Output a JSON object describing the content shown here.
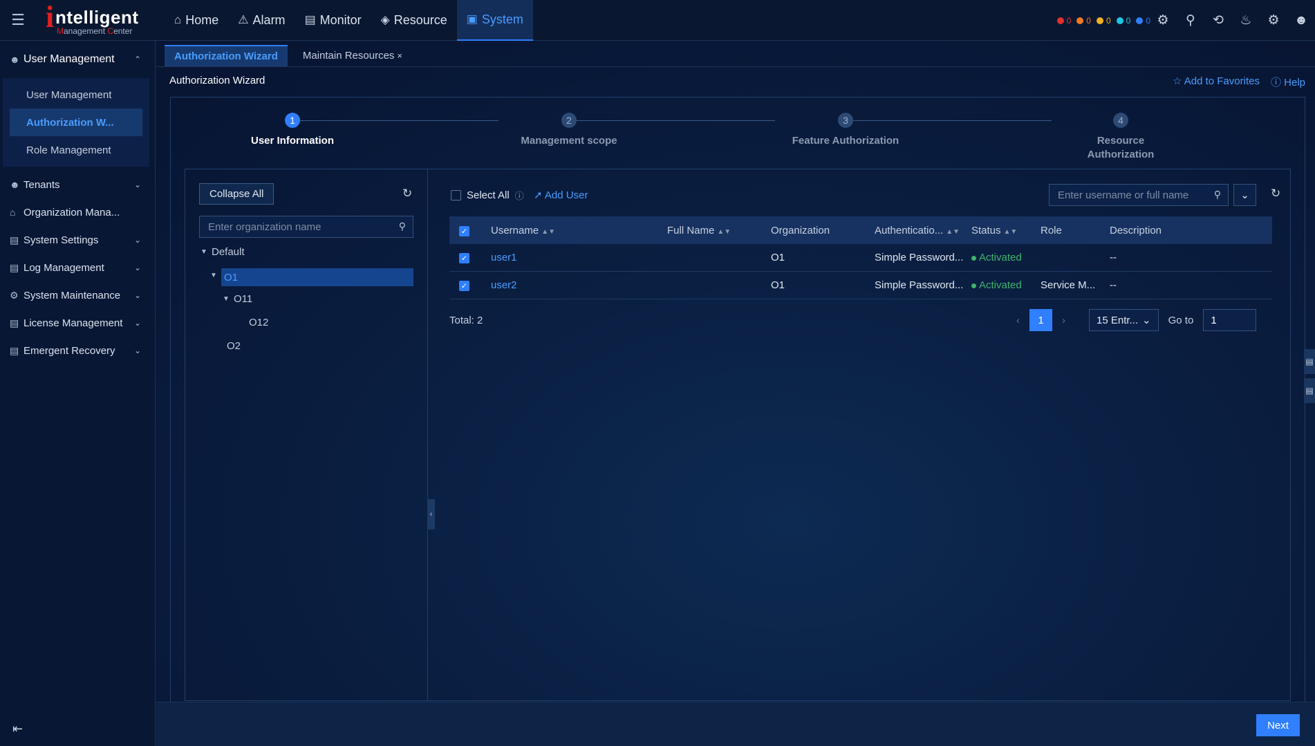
{
  "header": {
    "logo_main": "ntelligent",
    "logo_i": "i",
    "logo_sub_m": "M",
    "logo_sub_a": "anagement ",
    "logo_sub_c": "C",
    "logo_sub_b": "enter",
    "nav": [
      {
        "label": "Home",
        "icon": "home-icon"
      },
      {
        "label": "Alarm",
        "icon": "alarm-icon"
      },
      {
        "label": "Monitor",
        "icon": "monitor-icon"
      },
      {
        "label": "Resource",
        "icon": "resource-icon"
      },
      {
        "label": "System",
        "icon": "system-icon",
        "active": true
      }
    ],
    "alarms": [
      {
        "color": "#e0312f",
        "count": "0"
      },
      {
        "color": "#f07b1e",
        "count": "0"
      },
      {
        "color": "#f0b21e",
        "count": "0"
      },
      {
        "color": "#1ec9e0",
        "count": "0"
      },
      {
        "color": "#2f7fff",
        "count": "0"
      }
    ]
  },
  "sidebar": {
    "groups": [
      {
        "label": "User Management",
        "open": true
      },
      {
        "label": "Tenants"
      },
      {
        "label": "Organization Mana..."
      },
      {
        "label": "System Settings"
      },
      {
        "label": "Log Management"
      },
      {
        "label": "System Maintenance"
      },
      {
        "label": "License Management"
      },
      {
        "label": "Emergent Recovery"
      }
    ],
    "sub_items": [
      "User Management",
      "Authorization W...",
      "Role Management"
    ]
  },
  "tabs": [
    {
      "label": "Authorization Wizard",
      "active": true
    },
    {
      "label": "Maintain Resources",
      "close": "×"
    }
  ],
  "page": {
    "title": "Authorization Wizard",
    "favorites": "Add to Favorites",
    "help": "Help"
  },
  "steps": [
    {
      "num": "1",
      "label": "User Information",
      "active": true
    },
    {
      "num": "2",
      "label": "Management scope"
    },
    {
      "num": "3",
      "label": "Feature Authorization"
    },
    {
      "num": "4",
      "label": "Resource Authorization"
    }
  ],
  "org_panel": {
    "collapse_all": "Collapse All",
    "search_placeholder": "Enter organization name",
    "tree": [
      "Default",
      "O1",
      "O11",
      "O12",
      "O2"
    ]
  },
  "user_panel": {
    "select_all": "Select All",
    "add_user": "Add User",
    "search_placeholder": "Enter username or full name",
    "columns": [
      "Username",
      "Full Name",
      "Organization",
      "Authenticatio...",
      "Status",
      "Role",
      "Description"
    ],
    "rows": [
      {
        "username": "user1",
        "full_name": "",
        "organization": "O1",
        "auth": "Simple Password...",
        "status": "Activated",
        "role": "",
        "description": "--"
      },
      {
        "username": "user2",
        "full_name": "",
        "organization": "O1",
        "auth": "Simple Password...",
        "status": "Activated",
        "role": "Service M...",
        "description": "--"
      }
    ],
    "total": "Total: 2",
    "page": "1",
    "page_size": "15 Entr...",
    "goto_label": "Go to",
    "goto_value": "1"
  },
  "footer": {
    "next": "Next"
  },
  "colors": {
    "accent": "#2f7fff",
    "active_text": "#4a9dff",
    "status_green": "#3fb46c"
  }
}
